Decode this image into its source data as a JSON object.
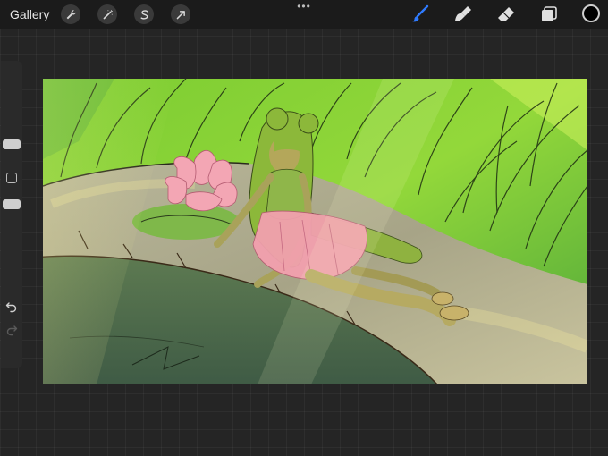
{
  "topbar": {
    "gallery_label": "Gallery",
    "actions": [
      {
        "name": "wrench-icon"
      },
      {
        "name": "magic-wand-icon"
      },
      {
        "name": "selection-icon"
      },
      {
        "name": "transform-arrow-icon"
      }
    ],
    "right_tools": [
      {
        "name": "brush-icon",
        "active": true,
        "color": "#2f7bff"
      },
      {
        "name": "smudge-icon",
        "active": false
      },
      {
        "name": "eraser-icon",
        "active": false
      },
      {
        "name": "layers-icon",
        "active": false
      }
    ],
    "current_color": "#000000"
  },
  "sidebar": {
    "undo_icon": "undo-icon",
    "redo_icon": "redo-icon"
  },
  "canvas": {
    "subject": "artwork-sketch"
  }
}
